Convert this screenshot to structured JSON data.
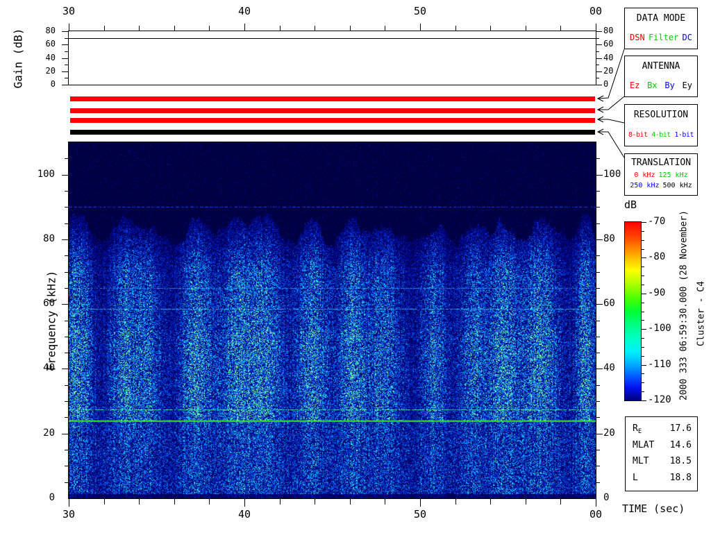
{
  "axis_labels": {
    "time": "TIME (sec)",
    "frequency": "Frequency (kHz)",
    "gain": "Gain (dB)"
  },
  "side_text": {
    "datetime": "2000 333 06:59:30.000 (28 November)",
    "spacecraft": "Cluster - C4"
  },
  "colorbar": {
    "label": "dB",
    "tick_labels": [
      "-70",
      "-80",
      "-90",
      "-100",
      "-110",
      "-120"
    ]
  },
  "status_bars": {
    "bars": [
      {
        "name": "data-mode-bar",
        "color": "#ff0000"
      },
      {
        "name": "antenna-bar",
        "color": "#ff0000"
      },
      {
        "name": "resolution-bar",
        "color": "#ff0000"
      },
      {
        "name": "translation-bar",
        "color": "#000000"
      }
    ]
  },
  "info_boxes": {
    "data_mode": {
      "title": "DATA MODE",
      "options": [
        {
          "label": "DSN",
          "color": "#ff0000"
        },
        {
          "label": "Filter",
          "color": "#00cc00"
        },
        {
          "label": "DC",
          "color": "#0000ff"
        }
      ]
    },
    "antenna": {
      "title": "ANTENNA",
      "options": [
        {
          "label": "Ez",
          "color": "#ff0000"
        },
        {
          "label": "Bx",
          "color": "#00cc00"
        },
        {
          "label": "By",
          "color": "#0000ff"
        },
        {
          "label": "Ey",
          "color": "#000000"
        }
      ]
    },
    "resolution": {
      "title": "RESOLUTION",
      "options": [
        {
          "label": "8-bit",
          "color": "#ff0000"
        },
        {
          "label": "4-bit",
          "color": "#00cc00"
        },
        {
          "label": "1-bit",
          "color": "#0000ff"
        }
      ]
    },
    "translation": {
      "title": "TRANSLATION",
      "row1": [
        {
          "label": "0 kHz",
          "color": "#ff0000"
        },
        {
          "label": "125 kHz",
          "color": "#00cc00"
        }
      ],
      "row2": [
        {
          "label": "250 kHz",
          "color": "#0000ff"
        },
        {
          "label": "500 kHz",
          "color": "#000000"
        }
      ]
    }
  },
  "ephemeris": {
    "rows": [
      {
        "label": "R",
        "sub": "E",
        "value": "17.6"
      },
      {
        "label": "MLAT",
        "sub": "",
        "value": "14.6"
      },
      {
        "label": "MLT",
        "sub": "",
        "value": "18.5"
      },
      {
        "label": "L",
        "sub": "",
        "value": "18.8"
      }
    ]
  },
  "chart_data": {
    "type": "heatmap",
    "title": "",
    "x": {
      "label": "TIME (sec)",
      "range": [
        30,
        60
      ],
      "major_ticks": [
        30,
        40,
        50,
        60
      ],
      "major_tick_labels": [
        "30",
        "40",
        "50",
        "00"
      ],
      "minor_tick_step": 2
    },
    "y": {
      "label": "Frequency (kHz)",
      "range": [
        0,
        110
      ],
      "major_ticks": [
        0,
        20,
        40,
        60,
        80,
        100
      ],
      "minor_tick_step": 5
    },
    "z": {
      "label": "dB",
      "range": [
        -120,
        -70
      ],
      "major_ticks": [
        -70,
        -80,
        -90,
        -100,
        -110,
        -120
      ],
      "minor_tick_step": 2.5,
      "colormap": "jet"
    },
    "gain_panel": {
      "ylabel": "Gain (dB)",
      "range": [
        0,
        80
      ],
      "major_ticks": [
        80,
        60,
        40,
        20,
        0
      ],
      "minor_tick_step": 10,
      "series": [
        {
          "name": "receiver-gain",
          "value_db": 70
        }
      ]
    },
    "features": {
      "noise_seed": 20001128,
      "plume_spacing_px": 56,
      "emission_top_khz": 84,
      "horizontal_lines_khz": [
        {
          "freq_khz": 90,
          "style": "dashed",
          "color": "#1a3cff"
        },
        {
          "freq_khz": 65,
          "style": "broken",
          "color": "#22bbee"
        },
        {
          "freq_khz": 58.5,
          "style": "broken",
          "color": "#33ddff"
        },
        {
          "freq_khz": 27.5,
          "style": "segmented",
          "color": "#44ffaa"
        },
        {
          "freq_khz": 24,
          "style": "solid",
          "color": "#33ee22"
        }
      ]
    }
  }
}
